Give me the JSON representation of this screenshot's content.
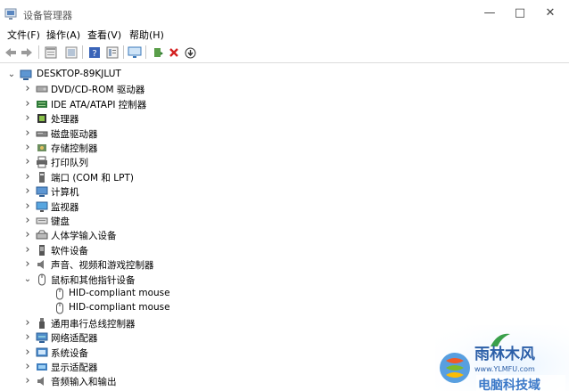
{
  "window": {
    "title": "设备管理器",
    "minimize_icon": "minimize-icon",
    "maximize_icon": "maximize-icon",
    "close_icon": "close-icon"
  },
  "menu": [
    "文件(F)",
    "操作(A)",
    "查看(V)",
    "帮助(H)"
  ],
  "toolbar": [
    "back-arrow-icon",
    "forward-arrow-icon",
    "show-hide-tree-icon",
    "properties-icon",
    "help-icon",
    "details-pane-icon",
    "monitor-scan-icon",
    "update-driver-icon",
    "uninstall-x-icon",
    "disable-device-icon"
  ],
  "tree": {
    "root": "DESKTOP-89KJLUT",
    "nodes": [
      {
        "label": "DVD/CD-ROM 驱动器",
        "icon": "dvd-drive-icon",
        "expanded": false
      },
      {
        "label": "IDE ATA/ATAPI 控制器",
        "icon": "ide-controller-icon",
        "expanded": false
      },
      {
        "label": "处理器",
        "icon": "processor-icon",
        "expanded": false
      },
      {
        "label": "磁盘驱动器",
        "icon": "disk-drive-icon",
        "expanded": false
      },
      {
        "label": "存储控制器",
        "icon": "storage-controller-icon",
        "expanded": false
      },
      {
        "label": "打印队列",
        "icon": "printer-icon",
        "expanded": false
      },
      {
        "label": "端口 (COM 和 LPT)",
        "icon": "port-icon",
        "expanded": false
      },
      {
        "label": "计算机",
        "icon": "computer-icon",
        "expanded": false
      },
      {
        "label": "监视器",
        "icon": "monitor-icon",
        "expanded": false
      },
      {
        "label": "键盘",
        "icon": "keyboard-icon",
        "expanded": false
      },
      {
        "label": "人体学输入设备",
        "icon": "hid-icon",
        "expanded": false
      },
      {
        "label": "软件设备",
        "icon": "software-device-icon",
        "expanded": false
      },
      {
        "label": "声音、视频和游戏控制器",
        "icon": "speaker-icon",
        "expanded": false
      },
      {
        "label": "鼠标和其他指针设备",
        "icon": "mouse-icon",
        "expanded": true
      },
      {
        "label": "HID-compliant mouse",
        "icon": "mouse-icon",
        "child": true
      },
      {
        "label": "HID-compliant mouse",
        "icon": "mouse-icon",
        "child": true
      },
      {
        "label": "通用串行总线控制器",
        "icon": "usb-icon",
        "expanded": false
      },
      {
        "label": "网络适配器",
        "icon": "network-adapter-icon",
        "expanded": false
      },
      {
        "label": "系统设备",
        "icon": "system-device-icon",
        "expanded": false
      },
      {
        "label": "显示适配器",
        "icon": "display-adapter-icon",
        "expanded": false
      },
      {
        "label": "音频输入和输出",
        "icon": "audio-io-icon",
        "expanded": false
      }
    ]
  },
  "watermark": {
    "brand": "雨林木风",
    "url": "www.YLMFU.com",
    "tagline": "电脑科技域"
  },
  "colors": {
    "accent": "#1e6fbf",
    "close_red": "#c42b1c"
  }
}
